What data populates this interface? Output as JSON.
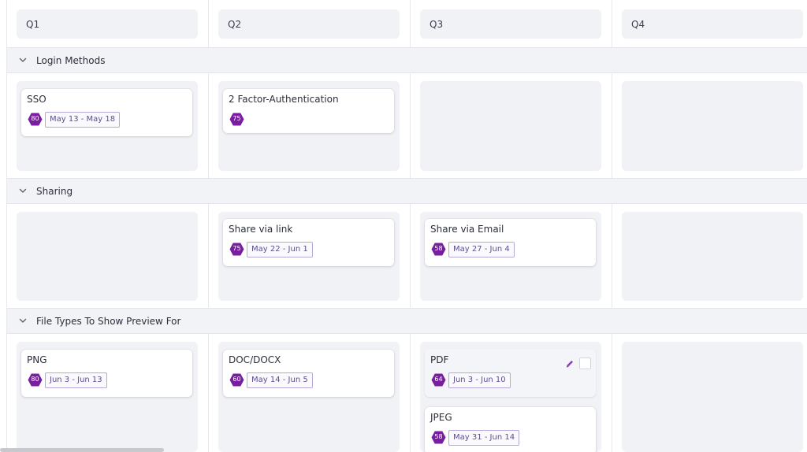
{
  "columns": [
    {
      "label": "Q1"
    },
    {
      "label": "Q2"
    },
    {
      "label": "Q3"
    },
    {
      "label": "Q4"
    }
  ],
  "groups": [
    {
      "label": "Login Methods",
      "cards": {
        "q1": [
          {
            "title": "SSO",
            "score": "80",
            "date": "May 13 - May 18"
          }
        ],
        "q2": [
          {
            "title": "2 Factor-Authentication",
            "score": "75",
            "date": ""
          }
        ]
      }
    },
    {
      "label": "Sharing",
      "cards": {
        "q2": [
          {
            "title": "Share via link",
            "score": "75",
            "date": "May 22 - Jun 1"
          }
        ],
        "q3": [
          {
            "title": "Share via Email",
            "score": "58",
            "date": "May 27 - Jun 4"
          }
        ]
      }
    },
    {
      "label": "File Types To Show Preview For",
      "cards": {
        "q1": [
          {
            "title": "PNG",
            "score": "80",
            "date": "Jun 3 - Jun 13"
          }
        ],
        "q2": [
          {
            "title": "DOC/DOCX",
            "score": "60",
            "date": "May 14 - Jun 5"
          }
        ],
        "q3": [
          {
            "title": "PDF",
            "score": "64",
            "date": "Jun 3 - Jun 10"
          },
          {
            "title": "JPEG",
            "score": "58",
            "date": "May 31 - Jun 14"
          }
        ]
      }
    }
  ],
  "icons": {
    "group_toggle": "chevron-down-icon",
    "score_badge": "hexagon-icon",
    "edit": "pencil-icon"
  },
  "colors": {
    "badge": "#7a1ea1",
    "date_border": "#b6a8d8",
    "cell_bg": "#f1f2f5"
  }
}
